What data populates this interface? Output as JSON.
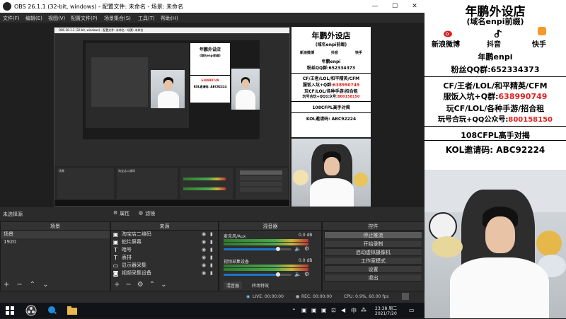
{
  "window": {
    "title": "OBS 26.1.1 (32-bit, windows) - 配置文件: 未命名 - 场景: 未命名",
    "minimize": "—",
    "maximize": "☐",
    "close": "✕"
  },
  "menu": [
    "文件(F)",
    "编辑(E)",
    "视图(V)",
    "配置文件(P)",
    "场景集合(S)",
    "工具(T)",
    "帮助(H)"
  ],
  "nested_window_title": "OBS 26.1.1 (32-bit, windows) - 配置文件: 未命名 - 场景: 未命名",
  "status_line": {
    "no_source": "未选择源",
    "properties": "属性",
    "filters": "滤镜"
  },
  "scenes": {
    "header": "场景",
    "items": [
      "场景",
      "1920"
    ]
  },
  "sources": {
    "header": "来源",
    "items": [
      {
        "icon": "image-icon",
        "label": "淘宝店二维码"
      },
      {
        "icon": "image-icon",
        "label": "蛇片屏幕"
      },
      {
        "icon": "text-icon",
        "label": "暗号"
      },
      {
        "icon": "text-icon",
        "label": "表排"
      },
      {
        "icon": "monitor-icon",
        "label": "显示器采集"
      },
      {
        "icon": "camera-icon",
        "label": "视频采集设备"
      }
    ]
  },
  "mixer": {
    "header": "混音器",
    "channels": [
      {
        "name": "麦克风/Aux",
        "db": "0.0 dB",
        "level": 0.8
      },
      {
        "name": "视频采集设备",
        "db": "0.0 dB",
        "level": 0.8
      }
    ],
    "tabs": [
      "混音器",
      "转场特效"
    ]
  },
  "controls": {
    "header": "控件",
    "buttons": [
      "停止推流",
      "开始录制",
      "启动虚拟摄像机",
      "工作室模式",
      "设置",
      "退出"
    ]
  },
  "statusbar": {
    "live": "LIVE: 00:00:00",
    "rec": "REC: 00:00:00",
    "cpu": "CPU: 0.9%, 60.00 fps"
  },
  "taskbar": {
    "time": "23:38 周二",
    "date": "2021/7/20"
  },
  "overlay": {
    "shop_title": "年鹏外设店",
    "shop_domain": "(域名enpi前缀)",
    "weibo": "新浪微博",
    "douyin": "抖音",
    "kuaishou": "快手",
    "name": "年鹏enpi",
    "fans_group_label": "粉丝QQ群:",
    "fans_group": "652334373",
    "line1": "CF/王者/LOL/和平精英/CFM",
    "line2_label": "服饭入坑+Q群:",
    "line2_value": "638990749",
    "line3": "玩CF/LOL/各种手游/招合租",
    "line4_label": "玩号合玩+QQ公众号:",
    "line4_value": "800158150",
    "line5": "108CFPL高手对揭",
    "line6": "KOL邀请码: ABC92224"
  },
  "colors": {
    "red": "#e0201e",
    "obs_bg": "#2b2b2b",
    "slider_blue": "#1e74c8"
  }
}
